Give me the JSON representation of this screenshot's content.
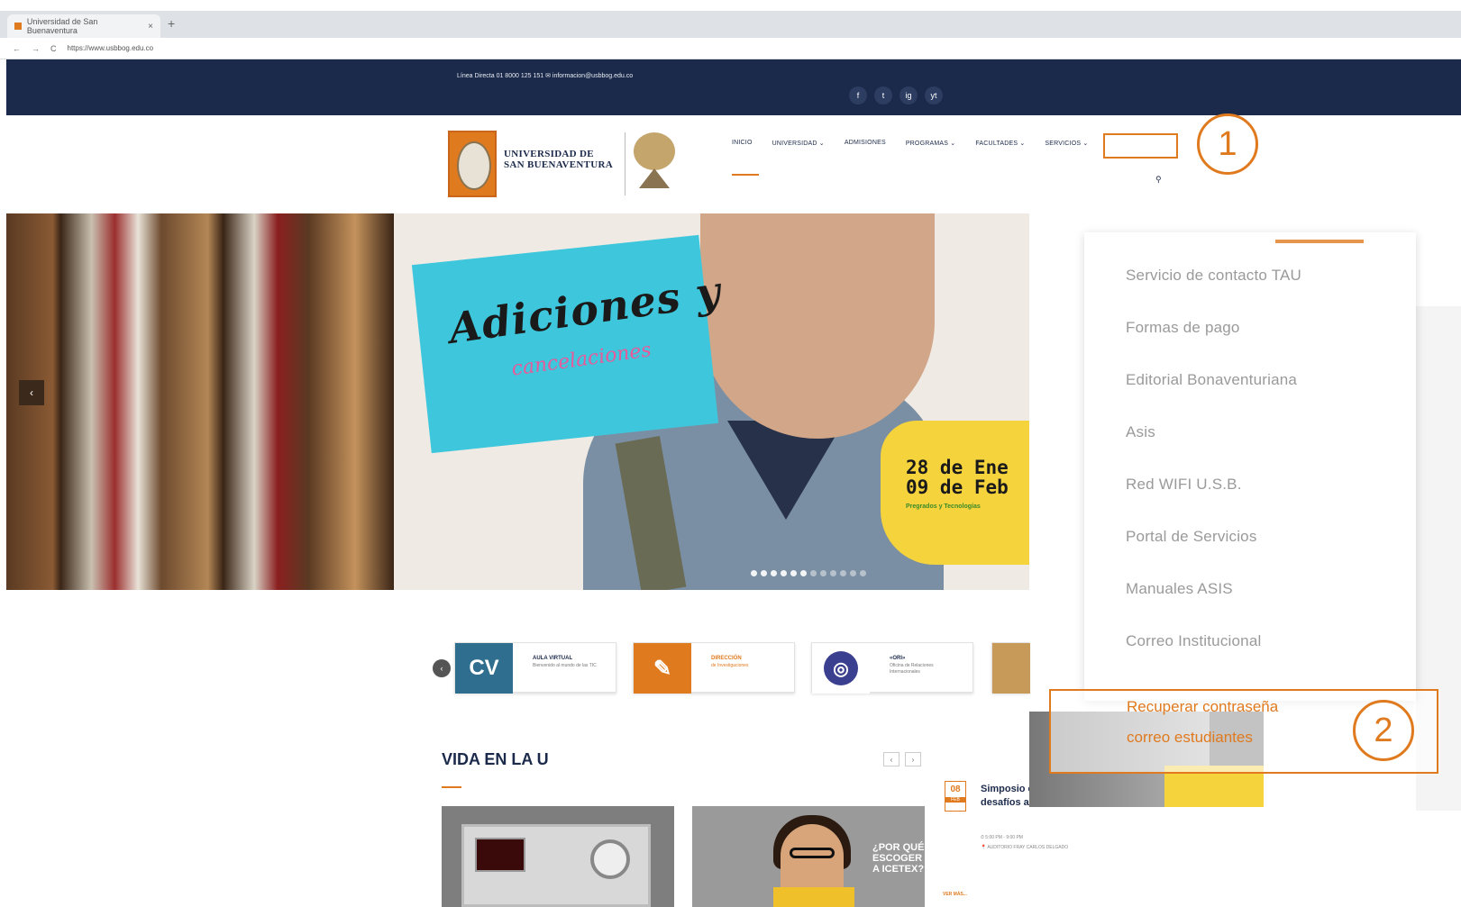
{
  "browser": {
    "tab_title": "Universidad de San Buenaventura",
    "tab_close": "×",
    "new_tab": "+",
    "url": "https://www.usbbog.edu.co",
    "back": "←",
    "forward": "→",
    "reload": "C"
  },
  "topbar": {
    "contact": "Línea Directa 01 8000 125 151  ✉ informacion@usbbog.edu.co",
    "social": [
      "f",
      "t",
      "ig",
      "yt"
    ]
  },
  "logo": {
    "line1": "UNIVERSIDAD DE",
    "line2": "SAN BUENAVENTURA"
  },
  "nav": {
    "items": [
      "INICIO",
      "UNIVERSIDAD ⌄",
      "ADMISIONES",
      "PROGRAMAS ⌄",
      "FACULTADES ⌄",
      "SERVICIOS ⌄"
    ],
    "search_icon": "⚲"
  },
  "callouts": {
    "one": "1",
    "two": "2"
  },
  "hero": {
    "headline": "Adiciones y",
    "subheadline": "cancelaciones",
    "date_line1": "28 de Ene",
    "date_line2": "09 de Feb",
    "date_sub": "Pregrados y Tecnologías",
    "prev": "‹",
    "slides_total": 12,
    "slide_active": 6
  },
  "quick_links": [
    {
      "icon": "CV",
      "title": "AULA VIRTUAL",
      "sub": "Bienvenido al mundo de las TIC",
      "color": "#2f6e8e"
    },
    {
      "icon": "✎",
      "title": "DIRECCIÓN",
      "sub": "de Investigaciones",
      "color": "#e07a1f"
    },
    {
      "icon": "◎",
      "title": "«ORI»",
      "sub": "Oficina de Relaciones Internacionales",
      "color": "#3b3f8f"
    }
  ],
  "quick_prev": "‹",
  "vida": {
    "title": "VIDA EN LA U",
    "prev": "‹",
    "next": "›",
    "ad_text": "¿POR QUÉ ESCOGER A ICETEX?",
    "event": {
      "day": "08",
      "month": "FEB",
      "title": "Simposio el Trabajo: perspectivas y desafíos actuales",
      "time": "⏱ 5:00 PM - 9:00 PM",
      "place": "📍 AUDITORIO FRAY CARLOS DELGADO",
      "more": "VER MÁS..."
    }
  },
  "servicios_menu": {
    "items": [
      "Servicio de contacto TAU",
      "Formas de pago",
      "Editorial Bonaventuriana",
      "Asis",
      "Red WIFI U.S.B.",
      "Portal de Servicios",
      "Manuales ASIS",
      "Correo Institucional"
    ],
    "recuperar_line1": "Recuperar contraseña",
    "recuperar_line2": "correo estudiantes"
  },
  "colors": {
    "accent": "#e07a1f",
    "navy": "#1b2a4a",
    "cyan": "#3ec7dc",
    "yellow": "#f5d33c"
  }
}
